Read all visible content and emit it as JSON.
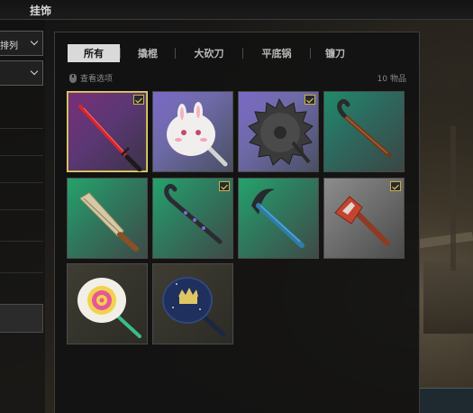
{
  "header": {
    "title": "挂饰"
  },
  "left_panel": {
    "sort_dropdown_label": "排列",
    "filter_dropdown_label": ""
  },
  "tabs": [
    {
      "label": "所有",
      "active": true
    },
    {
      "label": "撬棍",
      "active": false
    },
    {
      "label": "大砍刀",
      "active": false
    },
    {
      "label": "平底锅",
      "active": false
    },
    {
      "label": "镰刀",
      "active": false
    }
  ],
  "view_options_label": "查看选项",
  "item_count_label": "10 物品",
  "items": [
    {
      "icon": "red-katana-icon",
      "rarity_color": "#7a2f78",
      "checked": true,
      "selected": true
    },
    {
      "icon": "bunny-pan-icon",
      "rarity_color": "#7b69c7",
      "checked": false,
      "selected": false
    },
    {
      "icon": "saw-blade-icon",
      "rarity_color": "#7b69c7",
      "checked": true,
      "selected": false
    },
    {
      "icon": "crowbar-icon",
      "rarity_color": "#1f8b6a",
      "checked": false,
      "selected": false
    },
    {
      "icon": "machete-icon",
      "rarity_color": "#24a36b",
      "checked": false,
      "selected": false
    },
    {
      "icon": "purple-crowbar-icon",
      "rarity_color": "#24a36b",
      "checked": true,
      "selected": false
    },
    {
      "icon": "blue-sickle-icon",
      "rarity_color": "#24a36b",
      "checked": false,
      "selected": false
    },
    {
      "icon": "red-axe-icon",
      "rarity_color": "#8c8c8c",
      "checked": true,
      "selected": false
    },
    {
      "icon": "swirl-pan-icon",
      "rarity_color": "#3f3d33",
      "checked": false,
      "selected": false
    },
    {
      "icon": "crown-pan-icon",
      "rarity_color": "#3f3d33",
      "checked": false,
      "selected": false
    }
  ]
}
